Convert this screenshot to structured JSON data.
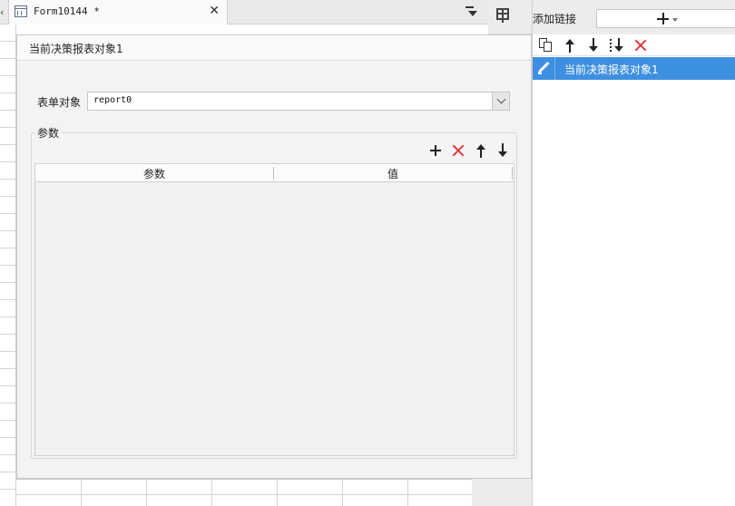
{
  "tabs": {
    "active": {
      "title": "Form10144 *",
      "close_glyph": "✕"
    },
    "prev_glyph": "‹"
  },
  "dialog": {
    "title": "当前决策报表对象1",
    "form_object": {
      "label": "表单对象",
      "value": "report0"
    },
    "params": {
      "legend": "参数",
      "columns": [
        "参数",
        "值"
      ],
      "rows": []
    }
  },
  "link_panel": {
    "add_link_label": "添加链接",
    "items": [
      {
        "label": "当前决策报表对象1",
        "selected": true
      }
    ]
  },
  "colors": {
    "selection": "#3d8fe0",
    "delete": "#e0383a"
  },
  "icons": [
    "tab-form-icon",
    "close-icon",
    "tab-menu-icon",
    "widget-layout-icon",
    "chevron-down-icon",
    "plus-icon",
    "delete-x-icon",
    "arrow-up-icon",
    "arrow-down-icon",
    "copy-icon",
    "move-to-bottom-icon",
    "edit-pencil-icon",
    "caret-down-icon"
  ]
}
